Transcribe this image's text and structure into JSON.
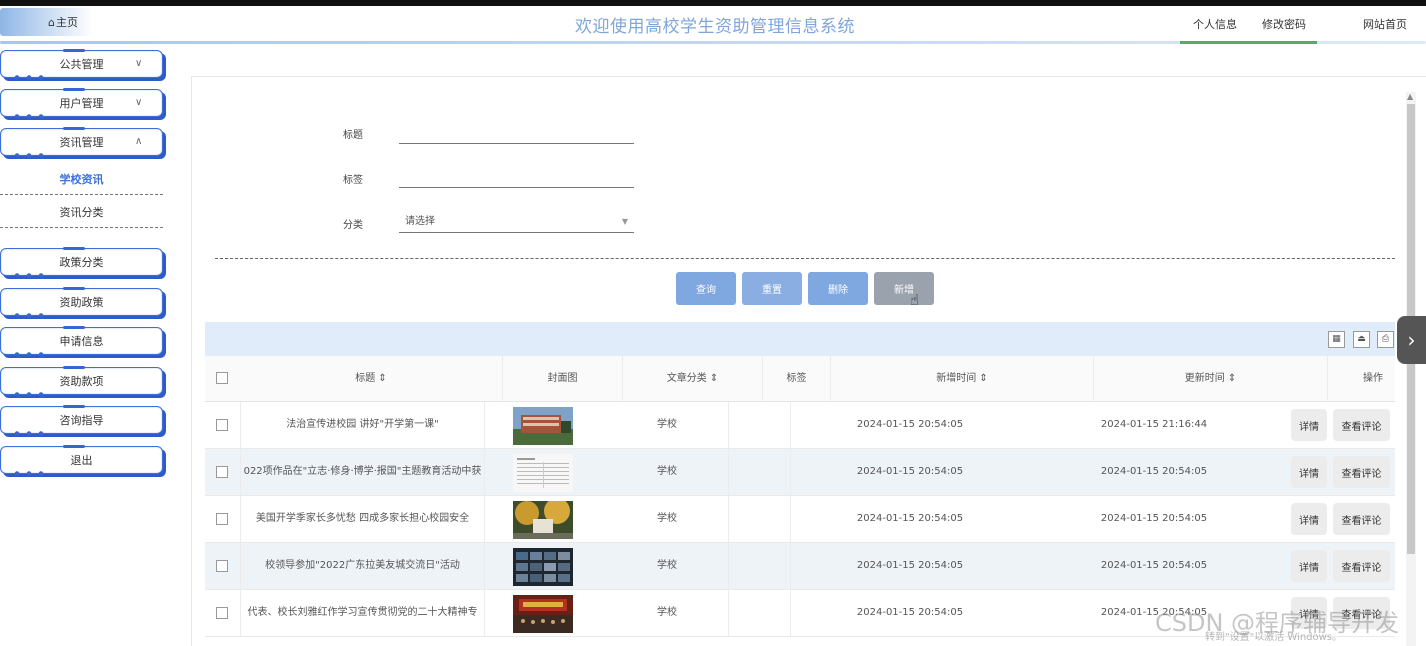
{
  "header": {
    "home_icon": "home-icon",
    "home_label": "主页",
    "system_title": "欢迎使用高校学生资助管理信息系统",
    "links": [
      "个人信息",
      "修改密码",
      "网站首页"
    ]
  },
  "sidebar": {
    "menus": [
      {
        "label": "公共管理",
        "chevron": "∨"
      },
      {
        "label": "用户管理",
        "chevron": "∨"
      },
      {
        "label": "资讯管理",
        "chevron": "∧"
      }
    ],
    "submenu": [
      {
        "label": "学校资讯",
        "active": true
      },
      {
        "label": "资讯分类",
        "active": false
      }
    ],
    "items": [
      "政策分类",
      "资助政策",
      "申请信息",
      "资助款项",
      "咨询指导",
      "退出"
    ]
  },
  "search": {
    "title_label": "标题",
    "tag_label": "标签",
    "category_label": "分类",
    "category_placeholder": "请选择",
    "title_value": "",
    "tag_value": ""
  },
  "actions": {
    "query": "查询",
    "reset": "重置",
    "delete": "删除",
    "add": "新增"
  },
  "colors": {
    "query": "#7fa7e0",
    "reset": "#8aaee2",
    "delete": "#7fa7e0",
    "add": "#9aa3ad",
    "title": "#7fa6da"
  },
  "table": {
    "columns": [
      "标题",
      "封面图",
      "文章分类",
      "标签",
      "新增时间",
      "更新时间",
      "操作"
    ],
    "sort_mark": "⇕",
    "detail_label": "详情",
    "comment_label": "查看评论",
    "rows": [
      {
        "title": "法治宣传进校园 讲好\"开学第一课\"",
        "category": "学校",
        "tag": "",
        "created": "2024-01-15 20:54:05",
        "updated": "2024-01-15 21:16:44",
        "thumb": "campus-building"
      },
      {
        "title": "022项作品在\"立志·修身·博学·报国\"主题教育活动中获",
        "category": "学校",
        "tag": "",
        "created": "2024-01-15 20:54:05",
        "updated": "2024-01-15 20:54:05",
        "thumb": "document"
      },
      {
        "title": "美国开学季家长多忧愁 四成多家长担心校园安全",
        "category": "学校",
        "tag": "",
        "created": "2024-01-15 20:54:05",
        "updated": "2024-01-15 20:54:05",
        "thumb": "autumn-campus"
      },
      {
        "title": "校领导参加\"2022广东拉美友城交流日\"活动",
        "category": "学校",
        "tag": "",
        "created": "2024-01-15 20:54:05",
        "updated": "2024-01-15 20:54:05",
        "thumb": "video-grid"
      },
      {
        "title": "代表、校长刘雅红作学习宣传贯彻党的二十大精神专",
        "category": "学校",
        "tag": "",
        "created": "2024-01-15 20:54:05",
        "updated": "2024-01-15 20:54:05",
        "thumb": "auditorium"
      }
    ]
  },
  "watermark": {
    "text": "CSDN @程序辅导开发",
    "sub": "转到\"设置\"以激活 Windows。"
  }
}
